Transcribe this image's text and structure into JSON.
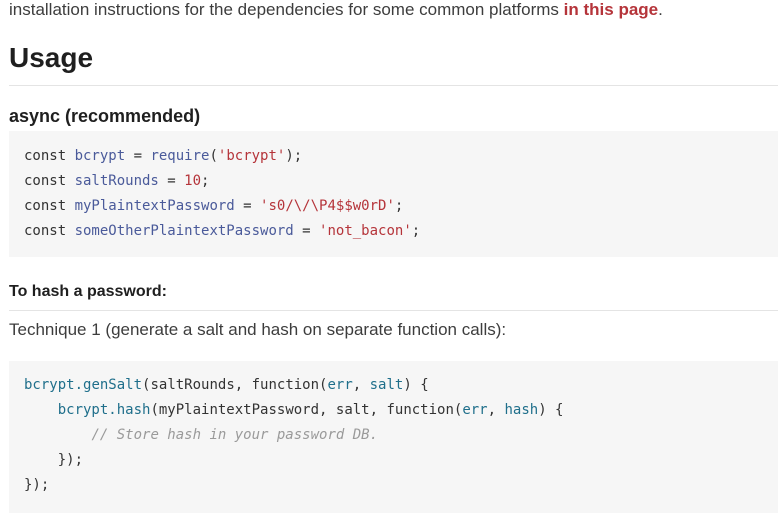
{
  "intro": {
    "text": "installation instructions for the dependencies for some common platforms ",
    "link": "in this page",
    "period": "."
  },
  "usage_heading": "Usage",
  "async_heading": "async (recommended)",
  "setup_code": {
    "line1": {
      "kw": "const ",
      "id": "bcrypt",
      "op": " = ",
      "fn": "require",
      "p1": "(",
      "str": "'bcrypt'",
      "p2": ");"
    },
    "line2": {
      "kw": "const ",
      "id": "saltRounds",
      "op": " = ",
      "num": "10",
      "end": ";"
    },
    "line3": {
      "kw": "const ",
      "id": "myPlaintextPassword",
      "op": " = ",
      "str": "'s0/\\/\\P4$$w0rD'",
      "end": ";"
    },
    "line4": {
      "kw": "const ",
      "id": "someOtherPlaintextPassword",
      "op": " = ",
      "str": "'not_bacon'",
      "end": ";"
    }
  },
  "hash_heading": "To hash a password:",
  "technique_text": "Technique 1 (generate a salt and hash on separate function calls):",
  "hash_code": {
    "line1": {
      "obj": "bcrypt.",
      "fn": "genSalt",
      "a": "(saltRounds, function(",
      "p1": "err",
      "c": ", ",
      "p2": "salt",
      "end": ") {"
    },
    "line2": {
      "indent": "    ",
      "obj": "bcrypt.",
      "fn": "hash",
      "a": "(myPlaintextPassword, salt, function(",
      "p1": "err",
      "c": ", ",
      "p2": "hash",
      "end": ") {"
    },
    "line3": {
      "indent": "        ",
      "comment": "// Store hash in your password DB."
    },
    "line4": {
      "text": "    });"
    },
    "line5": {
      "text": "});"
    }
  }
}
